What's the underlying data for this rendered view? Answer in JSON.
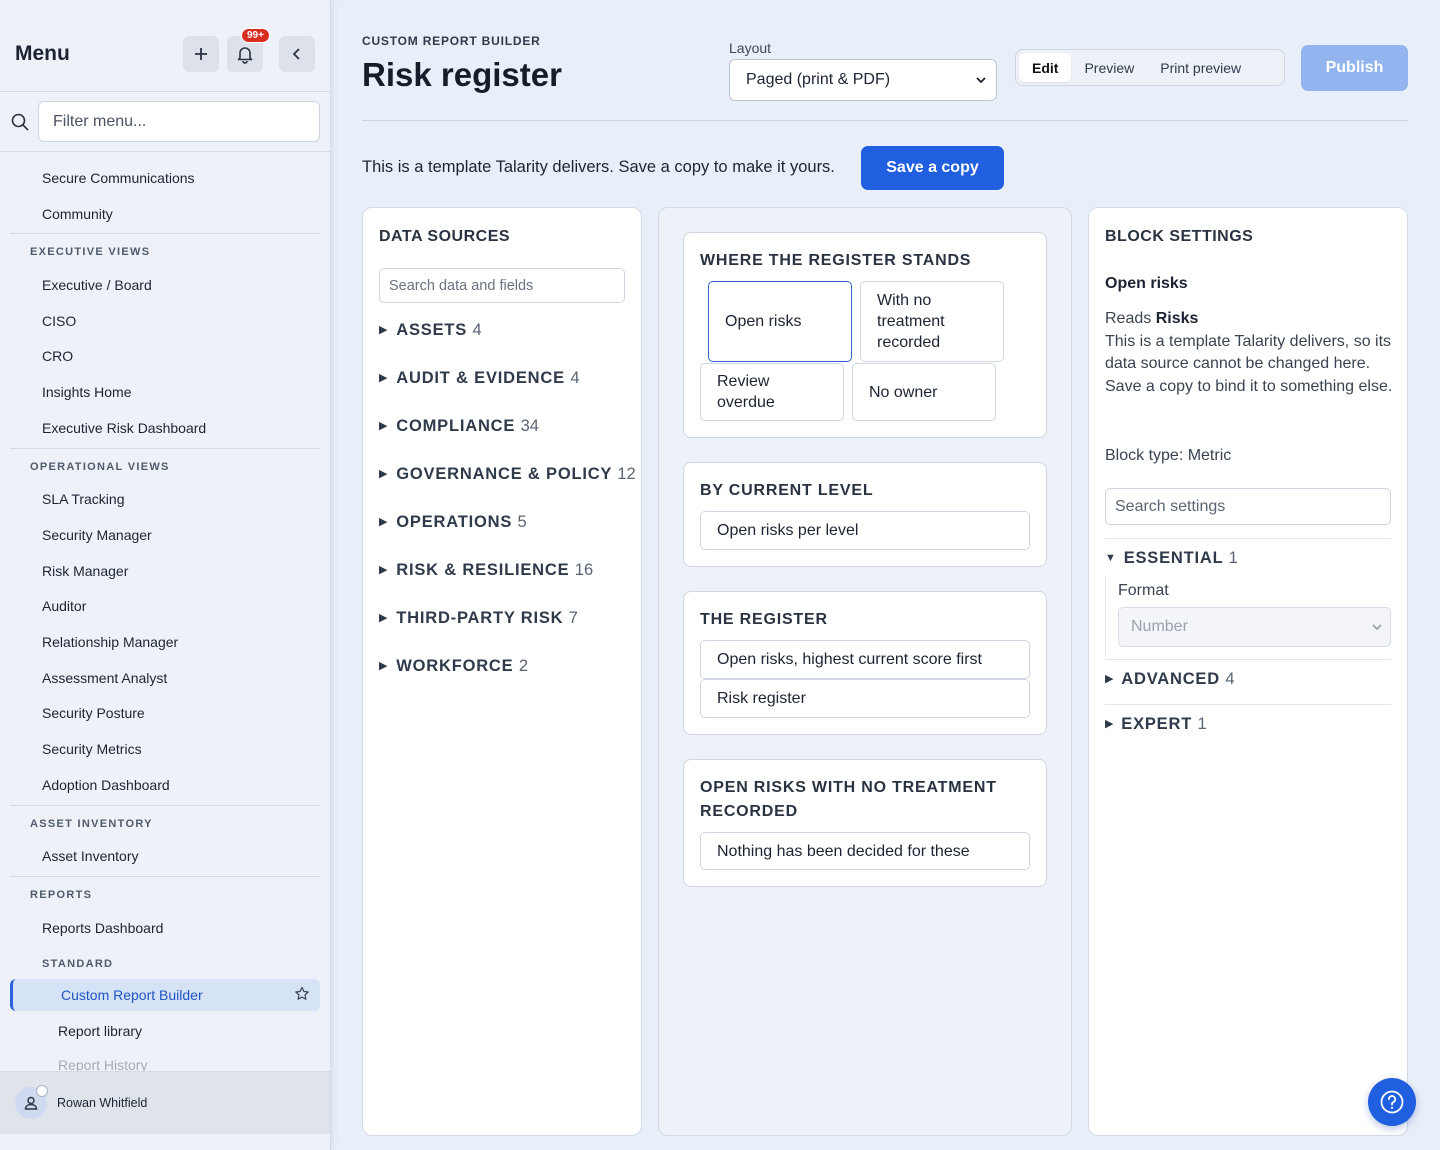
{
  "sidebar": {
    "title": "Menu",
    "badge": "99+",
    "filter_placeholder": "Filter menu...",
    "top_items": [
      "Secure Communications",
      "Community"
    ],
    "sections": [
      {
        "label": "EXECUTIVE VIEWS",
        "items": [
          "Executive / Board",
          "CISO",
          "CRO",
          "Insights Home",
          "Executive Risk Dashboard"
        ]
      },
      {
        "label": "OPERATIONAL VIEWS",
        "items": [
          "SLA Tracking",
          "Security Manager",
          "Risk Manager",
          "Auditor",
          "Relationship Manager",
          "Assessment Analyst",
          "Security Posture",
          "Security Metrics",
          "Adoption Dashboard"
        ]
      },
      {
        "label": "ASSET INVENTORY",
        "items": [
          "Asset Inventory"
        ]
      },
      {
        "label": "REPORTS",
        "items": [
          "Reports Dashboard"
        ]
      }
    ],
    "subsection": "STANDARD",
    "active_item": "Custom Report Builder",
    "sub_items": [
      "Report library",
      "Report History"
    ],
    "user_name": "Rowan Whitfield"
  },
  "header": {
    "breadcrumb": "CUSTOM REPORT BUILDER",
    "title": "Risk register",
    "layout_label": "Layout",
    "layout_value": "Paged (print & PDF)",
    "modes": [
      "Edit",
      "Preview",
      "Print preview"
    ],
    "active_mode": "Edit",
    "publish_label": "Publish"
  },
  "notice": {
    "text": "This is a template Talarity delivers. Save a copy to make it yours.",
    "button": "Save a copy"
  },
  "data_sources": {
    "title": "DATA SOURCES",
    "search_placeholder": "Search data and fields",
    "groups": [
      {
        "name": "ASSETS",
        "count": "4"
      },
      {
        "name": "AUDIT & EVIDENCE",
        "count": "4"
      },
      {
        "name": "COMPLIANCE",
        "count": "34"
      },
      {
        "name": "GOVERNANCE & POLICY",
        "count": "12"
      },
      {
        "name": "OPERATIONS",
        "count": "5"
      },
      {
        "name": "RISK & RESILIENCE",
        "count": "16"
      },
      {
        "name": "THIRD-PARTY RISK",
        "count": "7"
      },
      {
        "name": "WORKFORCE",
        "count": "2"
      }
    ]
  },
  "canvas": {
    "sections": [
      {
        "title": "WHERE THE REGISTER STANDS",
        "blocks": [
          "Open risks",
          "With no treatment recorded",
          "Review overdue",
          "No owner"
        ]
      },
      {
        "title": "BY CURRENT LEVEL",
        "blocks": [
          "Open risks per level"
        ]
      },
      {
        "title": "THE REGISTER",
        "blocks": [
          "Open risks, highest current score first",
          "Risk register"
        ]
      },
      {
        "title": "OPEN RISKS WITH NO TREATMENT RECORDED",
        "blocks": [
          "Nothing has been decided for these"
        ]
      }
    ]
  },
  "block_settings": {
    "title": "BLOCK SETTINGS",
    "block_name": "Open risks",
    "reads_prefix": "Reads",
    "reads_source": "Risks",
    "reads_note": "This is a template Talarity delivers, so its data source cannot be changed here. Save a copy to bind it to something else.",
    "block_type": "Block type: Metric",
    "search_placeholder": "Search settings",
    "groups": [
      {
        "name": "ESSENTIAL",
        "count": "1",
        "expanded": true
      },
      {
        "name": "ADVANCED",
        "count": "4",
        "expanded": false
      },
      {
        "name": "EXPERT",
        "count": "1",
        "expanded": false
      }
    ],
    "format_label": "Format",
    "format_value": "Number"
  },
  "colors": {
    "accent": "#1f5fe0",
    "publish_disabled": "#93b5ef",
    "badge": "#d92d20"
  },
  "icons": [
    "search-icon",
    "plus-icon",
    "bell-icon",
    "chevron-left-icon",
    "star-icon",
    "user-icon",
    "help-icon"
  ]
}
